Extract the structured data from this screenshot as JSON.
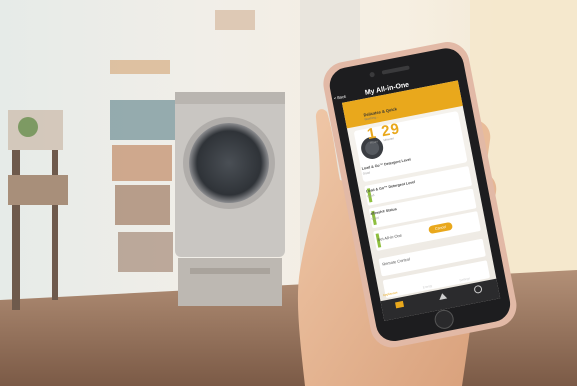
{
  "app": {
    "back_label": "< Back",
    "title": "My All-in-One",
    "cycle": {
      "name": "Delicates & Quick",
      "detail": "Washing...",
      "time": "1 29",
      "time_units": "Hours Minutes"
    },
    "rows": [
      {
        "label": "Load & Go™ Detergent Level",
        "sub": "Good"
      },
      {
        "label": "Load & Go™ Detergent Level",
        "sub": "Good"
      },
      {
        "label": "affresh® Status",
        "sub": "Good"
      }
    ],
    "set_label": "Set All-in-One",
    "cancel_label": "Cancel",
    "remote_label": "Remote Control",
    "nav": [
      {
        "label": "Appliances",
        "active": true
      },
      {
        "label": "Energy",
        "active": false
      },
      {
        "label": "Settings",
        "active": false
      }
    ],
    "accent_color": "#e9a81c"
  }
}
